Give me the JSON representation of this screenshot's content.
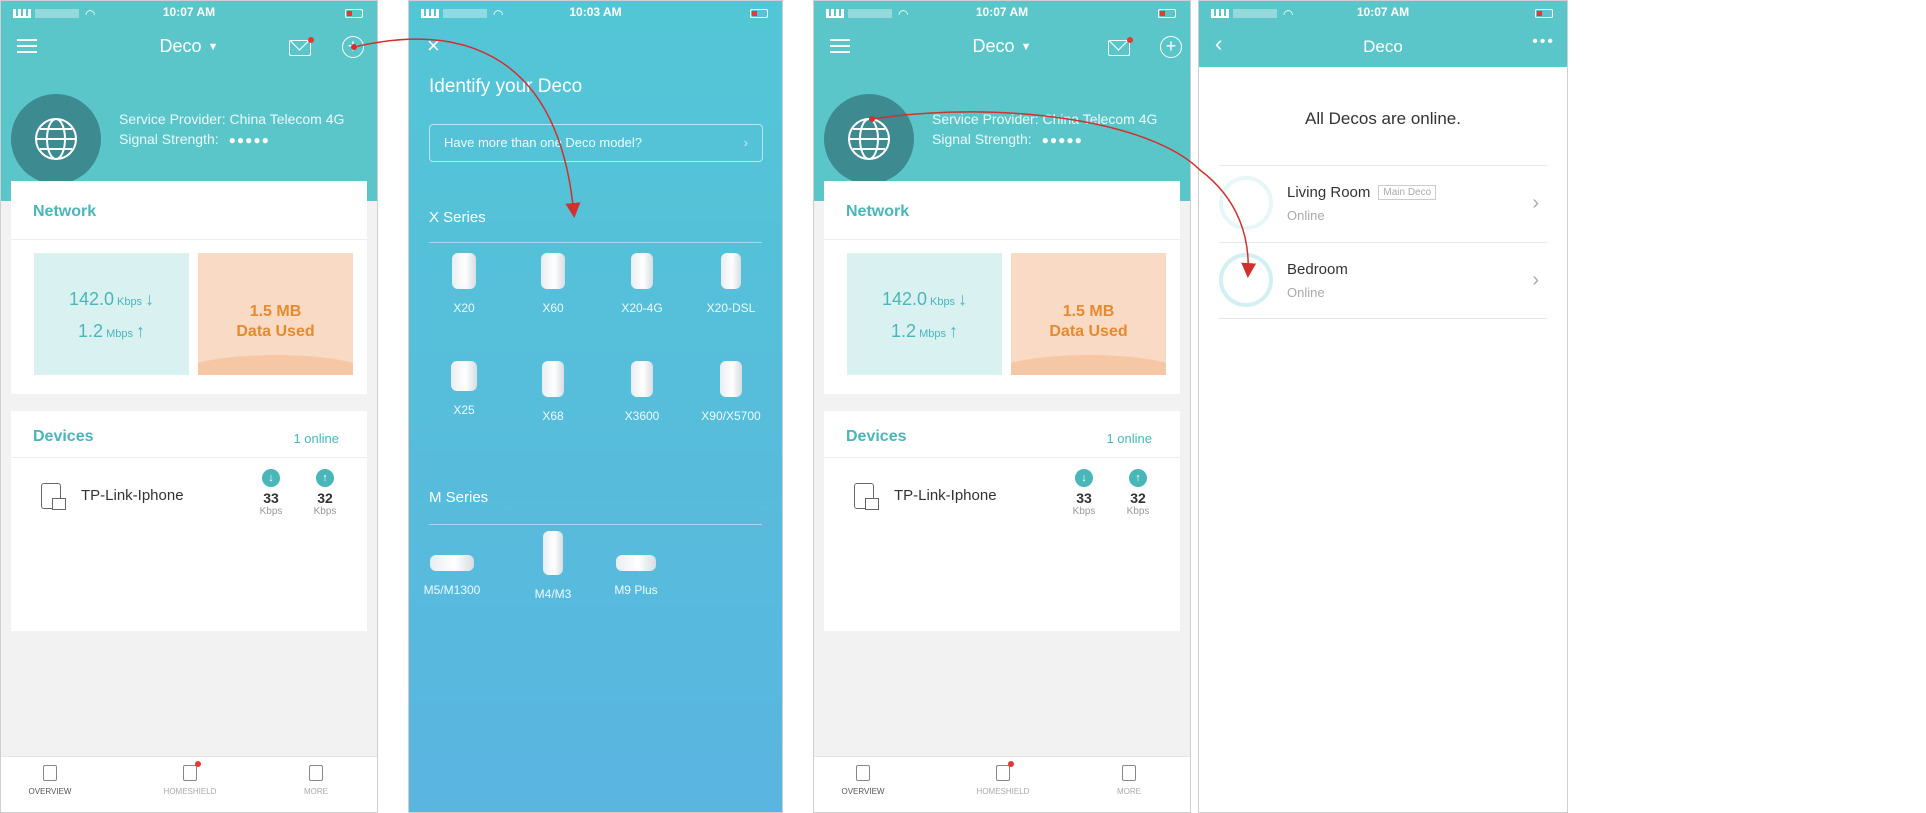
{
  "status": {
    "panel1_time": "10:07 AM",
    "panel2_time": "10:03 AM",
    "panel3_time": "10:07 AM",
    "panel4_time": "10:07 AM"
  },
  "dashboard": {
    "title": "Deco",
    "isp_label": "Service Provider: China Telecom 4G",
    "signal_label": "Signal Strength:",
    "signal_dots": "●●●●●",
    "network_title": "Network",
    "download_value": "142.0",
    "download_unit": "Kbps",
    "upload_value": "1.2",
    "upload_unit": "Mbps",
    "down_arrow": "↓",
    "up_arrow": "↑",
    "data_value": "1.5 MB",
    "data_label": "Data Used",
    "devices_title": "Devices",
    "devices_online": "1 online",
    "device_name": "TP-Link-Iphone",
    "device_down": "33",
    "device_up": "32",
    "rate_unit": "Kbps",
    "tabs": [
      "OVERVIEW",
      "HOMESHIELD",
      "MORE"
    ]
  },
  "identify": {
    "close": "×",
    "title": "Identify your Deco",
    "model_question": "Have more than one Deco model?",
    "x_series_title": "X Series",
    "x_models": [
      "X20",
      "X60",
      "X20-4G",
      "X20-DSL",
      "X25",
      "X68",
      "X3600",
      "X90/X5700"
    ],
    "m_series_title": "M Series",
    "m_models": [
      "M5/M1300",
      "M4/M3",
      "M9 Plus"
    ]
  },
  "deco_list": {
    "title": "Deco",
    "back": "‹",
    "more": "•••",
    "message": "All Decos are online.",
    "items": [
      {
        "name": "Living Room",
        "tag": "Main Deco",
        "status": "Online"
      },
      {
        "name": "Bedroom",
        "tag": "",
        "status": "Online"
      }
    ]
  },
  "colors": {
    "teal": "#5bc6c9",
    "accent": "#49b6b9",
    "arrow": "#d0312d",
    "data_orange": "#e58a2f"
  }
}
